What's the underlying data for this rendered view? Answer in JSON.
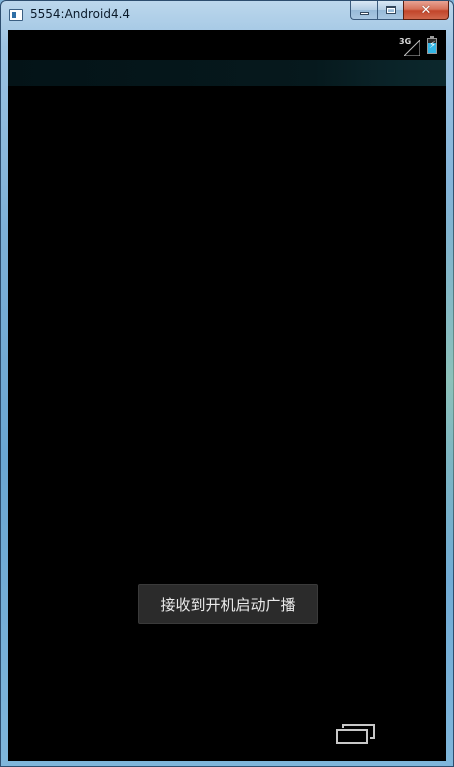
{
  "window": {
    "title": "5554:Android4.4",
    "minimize_icon": "minimize-icon",
    "maximize_icon": "maximize-icon",
    "close_icon": "close-icon",
    "close_glyph": "✕"
  },
  "statusbar": {
    "network_type": "3G",
    "signal_icon": "signal-icon",
    "battery_icon": "battery-charging-icon",
    "accent_color": "#33b5e5"
  },
  "toast": {
    "message": "接收到开机启动广播"
  },
  "navbar": {
    "recents_icon": "recent-apps-icon"
  }
}
